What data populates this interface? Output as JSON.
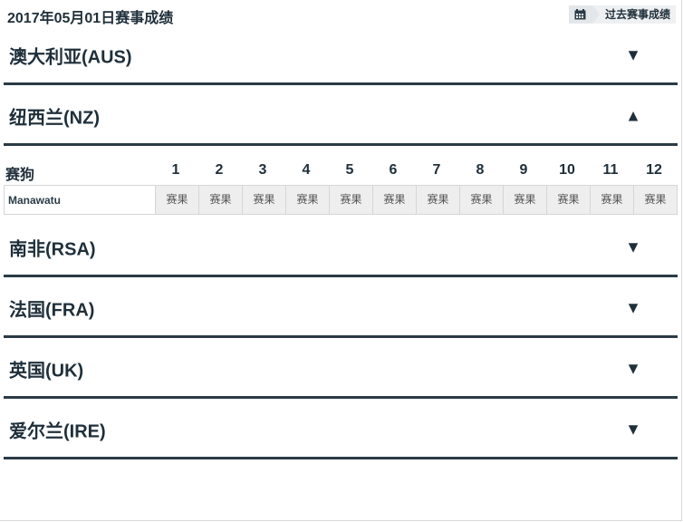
{
  "header": {
    "title": "2017年05月01日赛事成绩",
    "history_label": "过去赛事成绩",
    "history_icon": "calendar-icon"
  },
  "countries": [
    {
      "name": "澳大利亚(AUS)",
      "arrow": "▼",
      "expanded": false
    },
    {
      "name": "纽西兰(NZ)",
      "arrow": "▲",
      "expanded": true
    },
    {
      "name": "南非(RSA)",
      "arrow": "▼",
      "expanded": false
    },
    {
      "name": "法国(FRA)",
      "arrow": "▼",
      "expanded": false
    },
    {
      "name": "英国(UK)",
      "arrow": "▼",
      "expanded": false
    },
    {
      "name": "爱尔兰(IRE)",
      "arrow": "▼",
      "expanded": false
    }
  ],
  "race_table": {
    "label": "赛狗",
    "races": [
      "1",
      "2",
      "3",
      "4",
      "5",
      "6",
      "7",
      "8",
      "9",
      "10",
      "11",
      "12"
    ],
    "tracks": [
      {
        "name": "Manawatu",
        "results": [
          "赛果",
          "赛果",
          "赛果",
          "赛果",
          "赛果",
          "赛果",
          "赛果",
          "赛果",
          "赛果",
          "赛果",
          "赛果",
          "赛果"
        ]
      }
    ]
  }
}
